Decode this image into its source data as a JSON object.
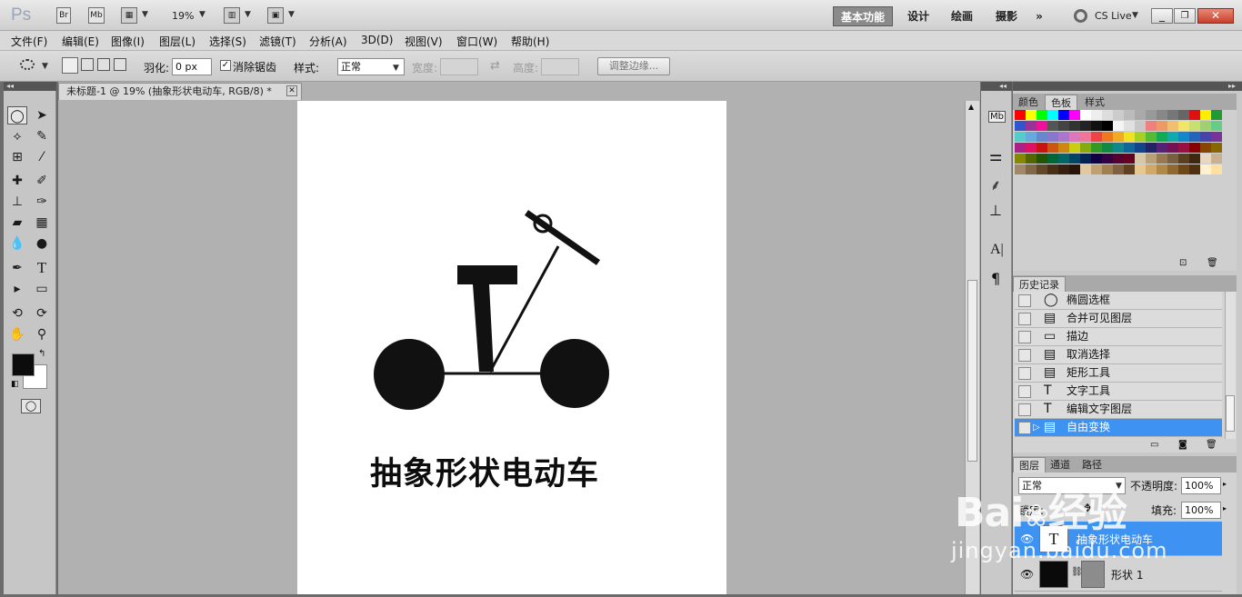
{
  "app": {
    "logo": "Ps",
    "bridge": "Br",
    "mini_bridge": "Mb",
    "zoom": "19%",
    "cs_live": "CS Live"
  },
  "workspaces": [
    "基本功能",
    "设计",
    "绘画",
    "摄影"
  ],
  "menu": [
    "文件(F)",
    "编辑(E)",
    "图像(I)",
    "图层(L)",
    "选择(S)",
    "滤镜(T)",
    "分析(A)",
    "3D(D)",
    "视图(V)",
    "窗口(W)",
    "帮助(H)"
  ],
  "options": {
    "feather_label": "羽化:",
    "feather_value": "0 px",
    "antialias_label": "消除锯齿",
    "style_label": "样式:",
    "style_value": "正常",
    "width_label": "宽度:",
    "height_label": "高度:",
    "refine_edge": "调整边缘..."
  },
  "document": {
    "tab_title": "未标题-1 @ 19% (抽象形状电动车, RGB/8) *",
    "artwork_text": "抽象形状电动车"
  },
  "panels": {
    "color_tabs": [
      "颜色",
      "色板",
      "样式"
    ],
    "history_title": "历史记录",
    "history": [
      {
        "label": "椭圆选框",
        "icon": "ellipse-marquee-icon",
        "glyph": "◯"
      },
      {
        "label": "合并可见图层",
        "icon": "document-icon",
        "glyph": "▤"
      },
      {
        "label": "描边",
        "icon": "stroke-icon",
        "glyph": "▭"
      },
      {
        "label": "取消选择",
        "icon": "document-icon",
        "glyph": "▤"
      },
      {
        "label": "矩形工具",
        "icon": "document-icon",
        "glyph": "▤"
      },
      {
        "label": "文字工具",
        "icon": "type-icon",
        "glyph": "T"
      },
      {
        "label": "编辑文字图层",
        "icon": "type-icon",
        "glyph": "T"
      },
      {
        "label": "自由变换",
        "icon": "document-icon",
        "glyph": "▤"
      }
    ],
    "history_selected": 7,
    "layers_tabs": [
      "图层",
      "通道",
      "路径"
    ],
    "blend_mode": "正常",
    "opacity_label": "不透明度:",
    "opacity_value": "100%",
    "lock_label": "锁定:",
    "fill_label": "填充:",
    "fill_value": "100%",
    "layers": [
      {
        "name": "抽象形状电动车",
        "type": "text",
        "selected": true
      },
      {
        "name": "形状 1",
        "type": "shape",
        "selected": false
      }
    ]
  },
  "watermark": {
    "brand": "Bai",
    "brand_tail": "经验",
    "url": "jingyan.baidu.com"
  },
  "swatch_rows": [
    [
      "#ff0000",
      "#ffff00",
      "#00ff00",
      "#00ffff",
      "#0000ff",
      "#ff00ff",
      "#ffffff",
      "#eeeeee",
      "#dddddd",
      "#cccccc",
      "#bbbbbb",
      "#aaaaaa",
      "#999999",
      "#888888",
      "#777777",
      "#666666",
      "#dd1111",
      "#ffee00",
      "#229933"
    ],
    [
      "#3355cc",
      "#993399",
      "#ee1199",
      "#555555",
      "#444444",
      "#333333",
      "#222222",
      "#111111",
      "#000000",
      "#f5f5f5",
      "#e0e0e0",
      "#c8c8c8",
      "#f08080",
      "#ee9966",
      "#f0c070",
      "#f2e56a",
      "#c8e070",
      "#a0d070",
      "#66cc88"
    ],
    [
      "#55cccc",
      "#66aadd",
      "#6688cc",
      "#8877cc",
      "#aa77cc",
      "#dd77bb",
      "#ee7799",
      "#ee4444",
      "#ee7722",
      "#f2aa22",
      "#f2e022",
      "#a6d022",
      "#55bb33",
      "#11aa55",
      "#11aaaa",
      "#1188cc",
      "#2266bb",
      "#4444aa",
      "#773399"
    ],
    [
      "#aa2288",
      "#dd1166",
      "#cc1111",
      "#cc5511",
      "#cc8811",
      "#cccc11",
      "#88aa11",
      "#339922",
      "#118844",
      "#118888",
      "#116699",
      "#114488",
      "#222266",
      "#552277",
      "#771155",
      "#991144",
      "#880000",
      "#884400",
      "#886600"
    ],
    [
      "#888800",
      "#556600",
      "#225500",
      "#006633",
      "#006666",
      "#004466",
      "#002255",
      "#110044",
      "#330044",
      "#550033",
      "#660022",
      "#d8c8a8",
      "#b8a078",
      "#987850",
      "#786040",
      "#584020",
      "#402810",
      "#e8d8c0",
      "#c8b090"
    ],
    [
      "#a08868",
      "#806848",
      "#604828",
      "#483018",
      "#382010",
      "#281408",
      "#e0c8a0",
      "#c0a070",
      "#a08050",
      "#806040",
      "#604020",
      "#e8c890",
      "#d0a868",
      "#b08848",
      "#906830",
      "#704818",
      "#503010",
      "#fff0d0",
      "#ffe0a0"
    ]
  ]
}
